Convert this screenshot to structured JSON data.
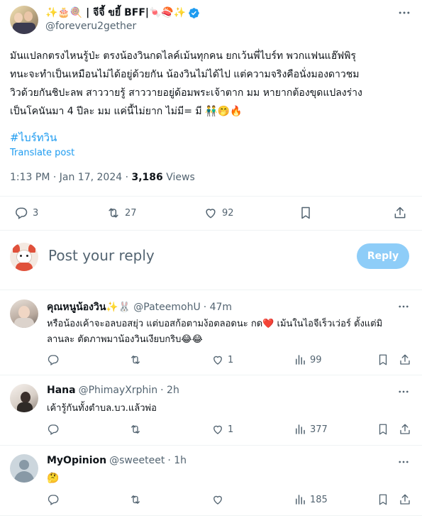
{
  "tweet": {
    "display_name": "✨🎂🍭 | จีจี้ ขยี้ BFF|🍬🍣✨",
    "handle": "@foreveru2gether",
    "body_line1": "มันแปลกตรงไหนรู้ป่ะ ตรงน้องวินกดไลค์เม้นทุกคน ยกเว้นพี่ไบร์ท พวกแฟนแฮ๊ฟพิรุ",
    "body_line2": "ทนะจะทำเป็นเหมือนไม่ได้อยู่ด้วยกัน น้องวินไม่ได้ไป แต่ความจริงคือนั่งมองดาวชม",
    "body_line3": "วิวด้วยกันชิปะลพ สาววายรู้ สาววายอยู่ด้อมพระเจ้าตาก มม หายากต้องขุดแปลงร่าง",
    "body_line4": "เป็นโคนันมา 4 ปีละ มม แค่นี้ไม่ยาก ไม่มี= มี 👬🤭🔥",
    "hashtag": "#ไบร์ทวิน",
    "translate": "Translate post",
    "time": "1:13 PM · Jan 17, 2024 · ",
    "views_count": "3,186",
    "views_label": " Views",
    "replies": "3",
    "reposts": "27",
    "likes": "92"
  },
  "reply_box": {
    "placeholder": "Post your reply",
    "button": "Reply"
  },
  "replies": [
    {
      "name": "คุณหนูน้องวิน✨🐰",
      "handle": "@PateemohU",
      "time": "· 47m",
      "line1": "หรือน้องเค้าจะอลบอสยุ่ว แต่บอสก้อตามง้อตลอดนะ กด❤️ เม้นในไอจีเร็วเว่อร์ ตั้งแต่มิ",
      "line2": "ลานละ ตัดภาพมาน้องวินเงียบกริบ😂😂",
      "comments": "",
      "reposts": "",
      "likes": "1",
      "views": "99"
    },
    {
      "name": "Hana",
      "handle": "@PhimayXrphin",
      "time": "· 2h",
      "line1": "เค้ารู้กันทั้งตำบล.บว.แล้วพ่อ",
      "comments": "",
      "reposts": "",
      "likes": "1",
      "views": "377"
    },
    {
      "name": "MyOpinion",
      "handle": "@sweeteet",
      "time": "· 1h",
      "line1": "🤔",
      "comments": "",
      "reposts": "",
      "likes": "",
      "views": "185"
    }
  ],
  "colors": {
    "accent": "#1d9bf0",
    "reply_button": "#8ecdf8",
    "muted": "#536471",
    "verified": "#1d9bf0"
  }
}
